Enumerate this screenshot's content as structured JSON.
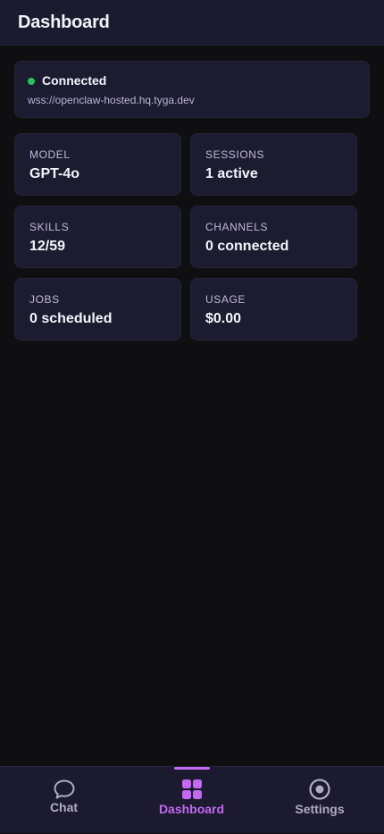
{
  "header": {
    "title": "Dashboard"
  },
  "connection": {
    "status": "Connected",
    "url": "wss://openclaw-hosted.hq.tyga.dev",
    "status_color": "#22c55e"
  },
  "stats": [
    {
      "label": "MODEL",
      "value": "GPT-4o"
    },
    {
      "label": "SESSIONS",
      "value": "1 active"
    },
    {
      "label": "SKILLS",
      "value": "12/59"
    },
    {
      "label": "CHANNELS",
      "value": "0 connected"
    },
    {
      "label": "JOBS",
      "value": "0 scheduled"
    },
    {
      "label": "USAGE",
      "value": "$0.00"
    }
  ],
  "nav": {
    "items": [
      {
        "label": "Chat",
        "icon": "chat-bubble-icon",
        "active": false
      },
      {
        "label": "Dashboard",
        "icon": "grid-icon",
        "active": true
      },
      {
        "label": "Settings",
        "icon": "radio-circle-icon",
        "active": false
      }
    ]
  },
  "colors": {
    "accent": "#c268f3",
    "background": "#0f0f11",
    "card": "#1c1b2f",
    "status_ok": "#22c55e"
  }
}
